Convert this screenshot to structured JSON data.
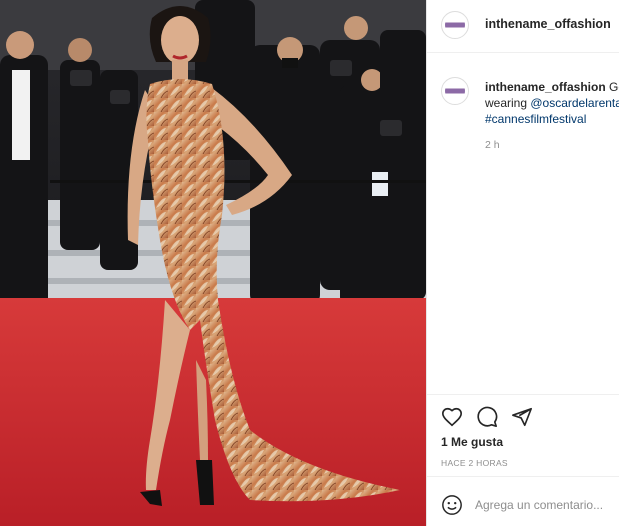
{
  "post": {
    "username": "inthename_offashion",
    "caption_lines": [
      "Gemma Chan",
      "wearing @oscardelarenta",
      "#cannesfilmfestival"
    ],
    "caption_first_text": "Ge",
    "caption_second_prefix": "wearing ",
    "mention": "@oscardelarenta",
    "hashtag": "#cannesfilmfestival",
    "timestamp": "2 h",
    "likes": "1 Me gusta",
    "posted_ago": "HACE 2 HORAS",
    "comment_placeholder": "Agrega un comentario..."
  },
  "icons": {
    "avatar": "brand-avatar-icon",
    "like": "heart-icon",
    "comment": "comment-bubble-icon",
    "share": "paper-plane-icon",
    "emoji": "smiley-face-icon"
  },
  "colors": {
    "carpet": "#c8262b",
    "link": "#00376b",
    "muted": "#8e8e8e",
    "text": "#262626"
  }
}
